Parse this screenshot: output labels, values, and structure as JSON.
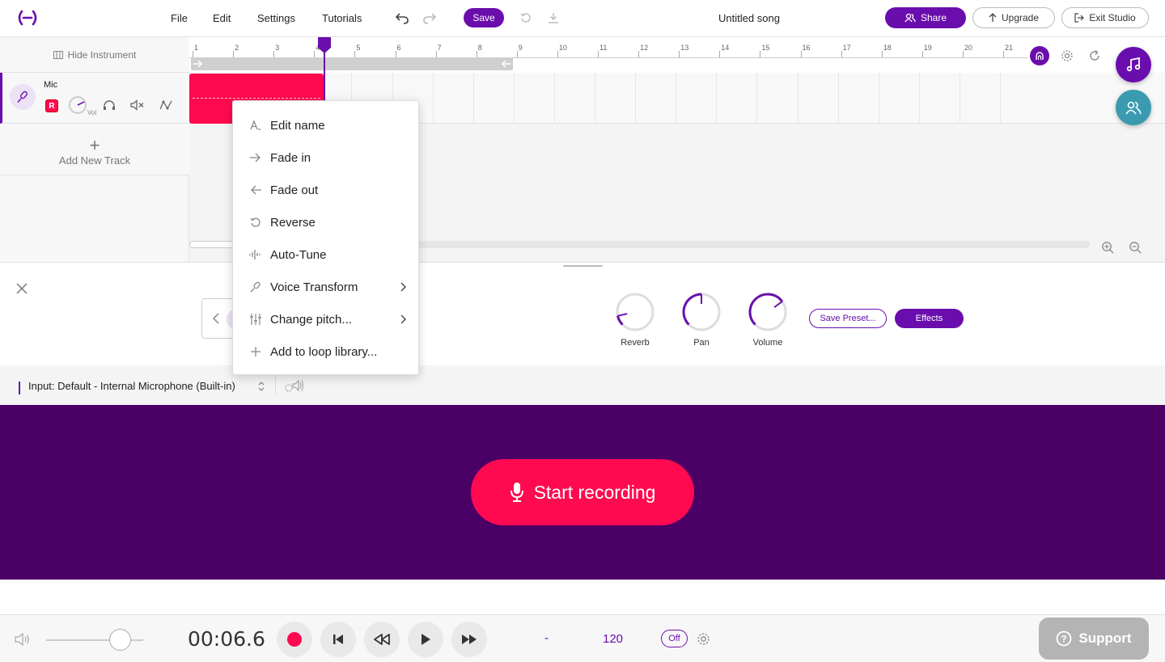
{
  "header": {
    "menu": [
      "File",
      "Edit",
      "Settings",
      "Tutorials"
    ],
    "save_label": "Save",
    "song_title": "Untitled song",
    "share_label": "Share",
    "upgrade_label": "Upgrade",
    "exit_label": "Exit Studio"
  },
  "tracks": {
    "hide_instrument_label": "Hide Instrument",
    "track_name": "Mic",
    "rec_badge": "R",
    "vol_label": "Vol",
    "add_track_label": "Add New Track"
  },
  "ruler": {
    "numbers": [
      "1",
      "2",
      "3",
      "4",
      "5",
      "6",
      "7",
      "8",
      "9",
      "10",
      "11",
      "12",
      "13",
      "14",
      "15",
      "16",
      "17",
      "18",
      "19",
      "20",
      "21"
    ]
  },
  "context_menu": {
    "items": [
      {
        "label": "Edit name",
        "icon": "text-cursor-icon"
      },
      {
        "label": "Fade in",
        "icon": "arrow-right-icon"
      },
      {
        "label": "Fade out",
        "icon": "arrow-left-icon"
      },
      {
        "label": "Reverse",
        "icon": "reverse-icon"
      },
      {
        "label": "Auto-Tune",
        "icon": "autotune-icon"
      },
      {
        "label": "Voice Transform",
        "icon": "wand-icon",
        "submenu": true
      },
      {
        "label": "Change pitch...",
        "icon": "sliders-icon",
        "submenu": true
      },
      {
        "label": "Add to loop library...",
        "icon": "plus-icon"
      }
    ]
  },
  "effects": {
    "knobs": [
      {
        "label": "Reverb",
        "value": 0.12
      },
      {
        "label": "Pan",
        "value": 0.5
      },
      {
        "label": "Volume",
        "value": 0.7
      }
    ],
    "save_preset_label": "Save Preset...",
    "effects_label": "Effects"
  },
  "input": {
    "label": "Input: Default - Internal Microphone (Built-in)"
  },
  "recording": {
    "start_label": "Start recording"
  },
  "transport": {
    "time": "00:06.6",
    "key": "-",
    "bpm": "120",
    "metronome": "Off",
    "master_volume": 0.78
  },
  "support_label": "Support",
  "colors": {
    "accent": "#6a0dad",
    "record": "#ff0a50",
    "record_panel": "#4b0066",
    "teal": "#3a9bb0"
  }
}
